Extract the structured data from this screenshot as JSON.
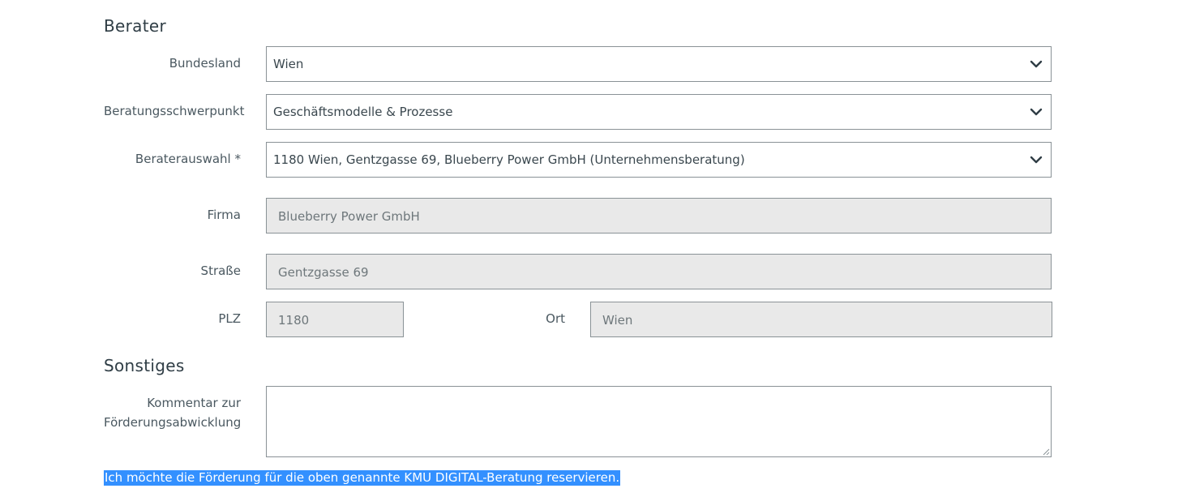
{
  "berater": {
    "title": "Berater",
    "bundesland": {
      "label": "Bundesland",
      "value": "Wien"
    },
    "schwerpunkt": {
      "label": "Beratungsschwerpunkt",
      "value": "Geschäftsmodelle & Prozesse"
    },
    "auswahl": {
      "label": "Beraterauswahl *",
      "value": "1180 Wien, Gentzgasse 69, Blueberry Power GmbH (Unternehmensberatung)"
    },
    "firma": {
      "label": "Firma",
      "value": "Blueberry Power GmbH"
    },
    "strasse": {
      "label": "Straße",
      "value": "Gentzgasse 69"
    },
    "plz": {
      "label": "PLZ",
      "value": "1180"
    },
    "ort": {
      "label": "Ort",
      "value": "Wien"
    }
  },
  "sonstiges": {
    "title": "Sonstiges",
    "kommentar": {
      "label_line1": "Kommentar zur",
      "label_line2": "Förderungsabwicklung",
      "value": ""
    }
  },
  "reserve_text": "Ich möchte die Förderung für die oben genannte KMU DIGITAL-Beratung reservieren.",
  "icons": {
    "select_chevron": "chevron-down-icon",
    "resize": "resize-grip-icon"
  },
  "colors": {
    "border": "#8a9296",
    "readonly_bg": "#e9e9e9",
    "selection": "#3390ff"
  }
}
